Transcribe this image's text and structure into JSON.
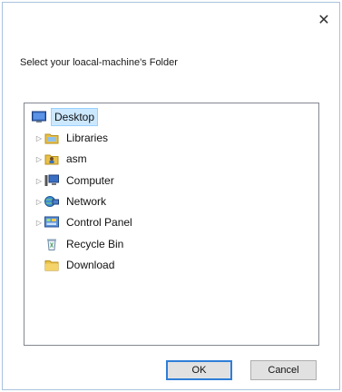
{
  "dialog": {
    "close_glyph": "✕",
    "prompt": "Select your loacal-machine's Folder"
  },
  "tree": {
    "items": [
      {
        "label": "Desktop",
        "icon": "desktop-icon",
        "expandable": false,
        "selected": true
      },
      {
        "label": "Libraries",
        "icon": "libraries-icon",
        "expandable": true
      },
      {
        "label": "asm",
        "icon": "user-folder-icon",
        "expandable": true
      },
      {
        "label": "Computer",
        "icon": "computer-icon",
        "expandable": true
      },
      {
        "label": "Network",
        "icon": "network-icon",
        "expandable": true
      },
      {
        "label": "Control Panel",
        "icon": "control-panel-icon",
        "expandable": true
      },
      {
        "label": "Recycle Bin",
        "icon": "recycle-bin-icon",
        "expandable": false
      },
      {
        "label": "Download",
        "icon": "folder-icon",
        "expandable": false
      }
    ],
    "expander_glyph": "▷"
  },
  "buttons": {
    "ok_label": "OK",
    "cancel_label": "Cancel"
  },
  "colors": {
    "accent": "#2f7ed8",
    "selection": "#cce8ff",
    "folder": "#e8c14a"
  }
}
